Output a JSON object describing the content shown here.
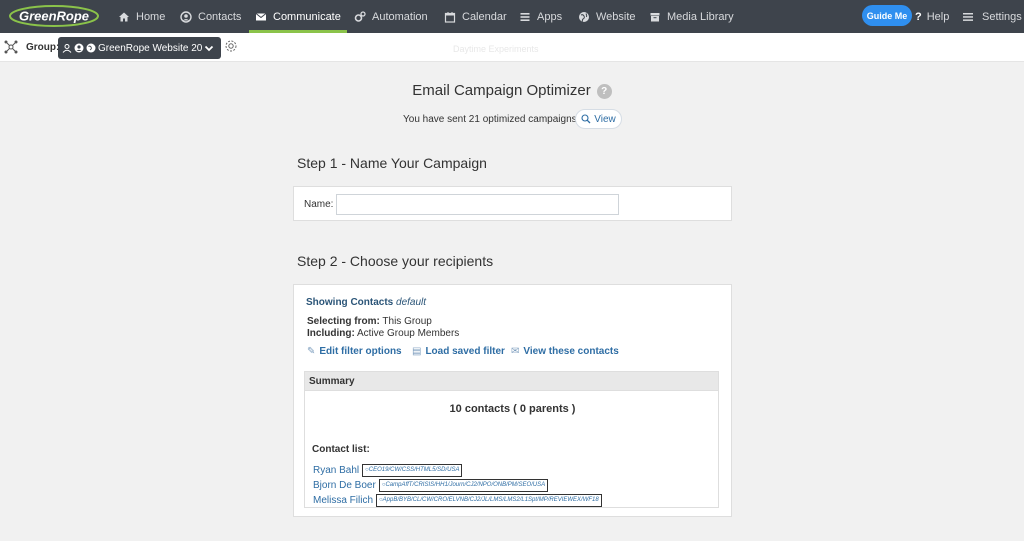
{
  "brand": "GreenRope",
  "nav": {
    "home": "Home",
    "contacts": "Contacts",
    "communicate": "Communicate",
    "automation": "Automation",
    "calendar": "Calendar",
    "apps": "Apps",
    "website": "Website",
    "media_library": "Media Library",
    "guide_me": "Guide Me",
    "help": "Help",
    "settings": "Settings"
  },
  "groupbar": {
    "label": "Group:",
    "selected_group": "GreenRope Website 20",
    "faint_text": "Daytime Experiments"
  },
  "page": {
    "title": "Email Campaign Optimizer",
    "help_glyph": "?",
    "sent_text": "You have sent 21 optimized campaigns",
    "view_label": "View"
  },
  "step1": {
    "heading": "Step 1 - Name Your Campaign",
    "name_label": "Name:",
    "name_value": ""
  },
  "step2": {
    "heading": "Step 2 - Choose your recipients",
    "showing_label": "Showing Contacts",
    "showing_value": "default",
    "selecting_label": "Selecting from:",
    "selecting_value": "This Group",
    "including_label": "Including:",
    "including_value": "Active Group Members",
    "edit_filter": "Edit filter options",
    "load_filter": "Load saved filter",
    "view_contacts": "View these contacts",
    "summary_title": "Summary",
    "contact_count": "10 contacts ( 0 parents )",
    "contact_list_label": "Contact list:",
    "contacts": [
      {
        "name": "Ryan Bahl",
        "tags": "CEO19/CW/CSS/HTML5/SD/USA"
      },
      {
        "name": "Bjorn De Boer",
        "tags": "CampAffT/CRISIS/HH1/Journ/CJ2/NPO/ONB/PM/SEO/USA"
      },
      {
        "name": "Melissa Filich",
        "tags": "AppB/BYB/CL/CW/CRO/ELVNB/CJ2/JL/LMS/LMS2/L1Spt/MP/REVIEWEX/WF18"
      }
    ]
  },
  "colors": {
    "nav_bg": "#3e444c",
    "active_underline": "#8bc34a",
    "guide_button": "#2f8fef",
    "link": "#2e6da4"
  }
}
